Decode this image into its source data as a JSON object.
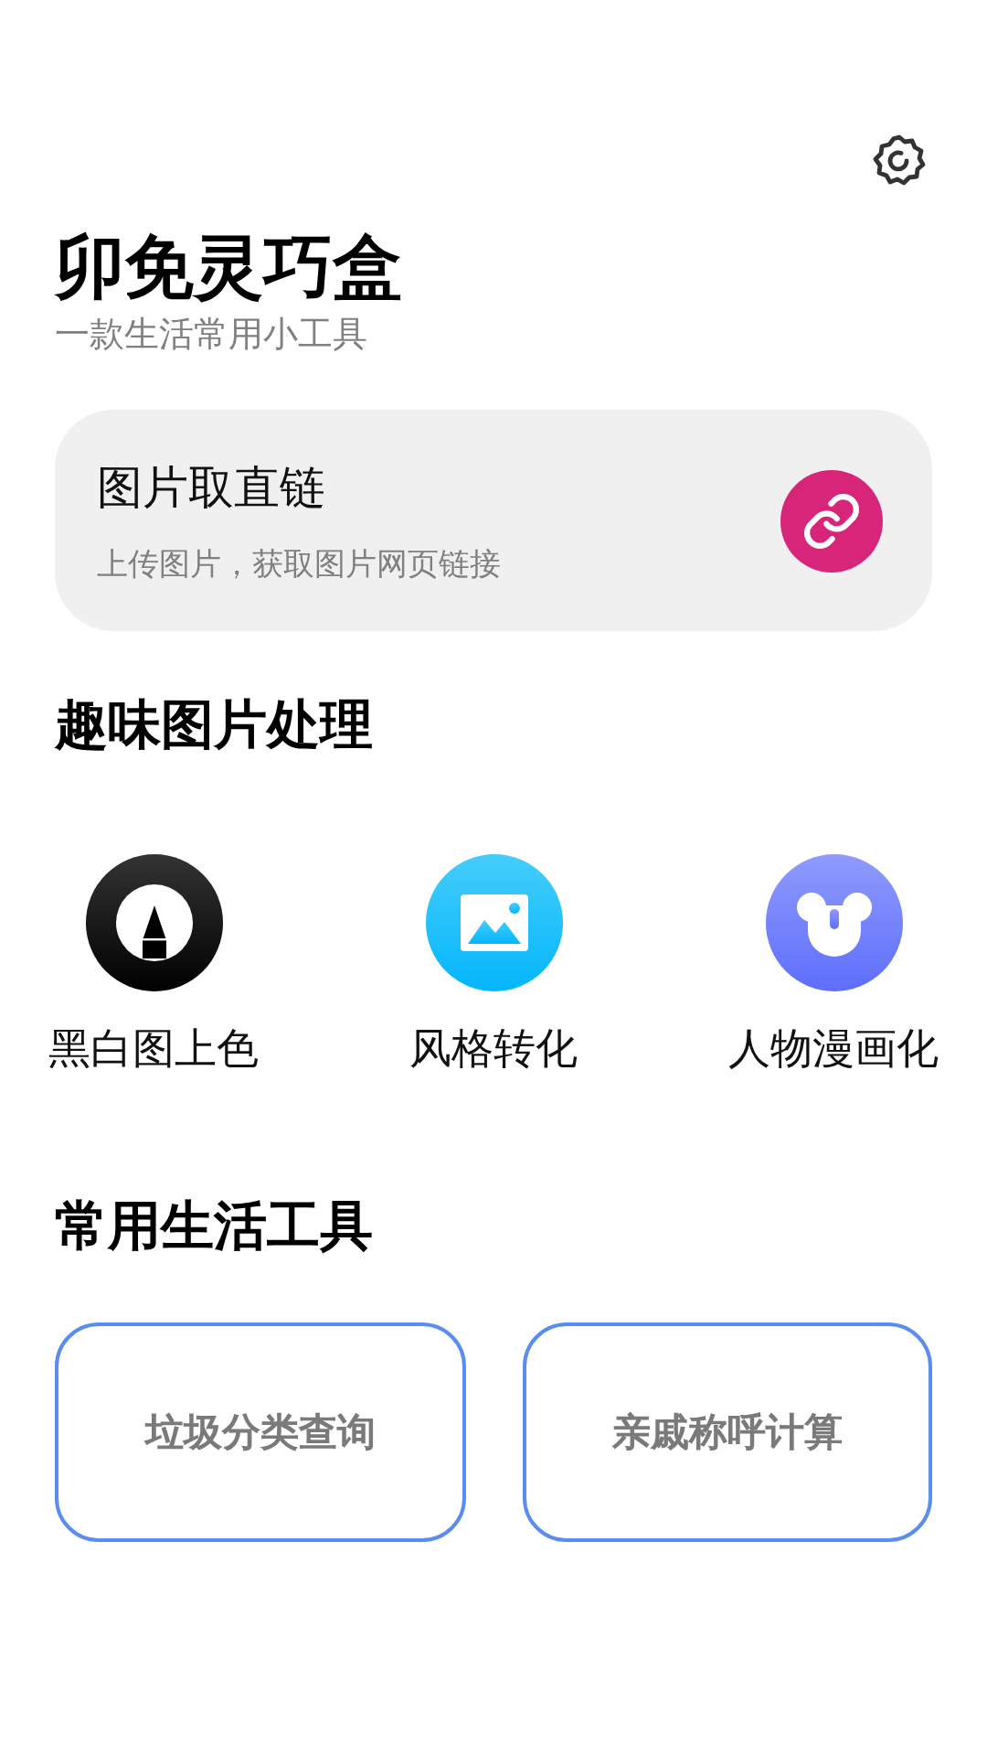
{
  "app": {
    "title": "卯免灵巧盒",
    "subtitle": "一款生活常用小工具"
  },
  "feature_card": {
    "title": "图片取直链",
    "description": "上传图片，获取图片网页链接"
  },
  "image_tools": {
    "heading": "趣味图片处理",
    "items": [
      {
        "label": "黑白图上色",
        "kind": "colorize"
      },
      {
        "label": "风格转化",
        "kind": "style"
      },
      {
        "label": "人物漫画化",
        "kind": "cartoon"
      }
    ]
  },
  "life_tools": {
    "heading": "常用生活工具",
    "items": [
      "垃圾分类查询",
      "亲戚称呼计算"
    ]
  }
}
